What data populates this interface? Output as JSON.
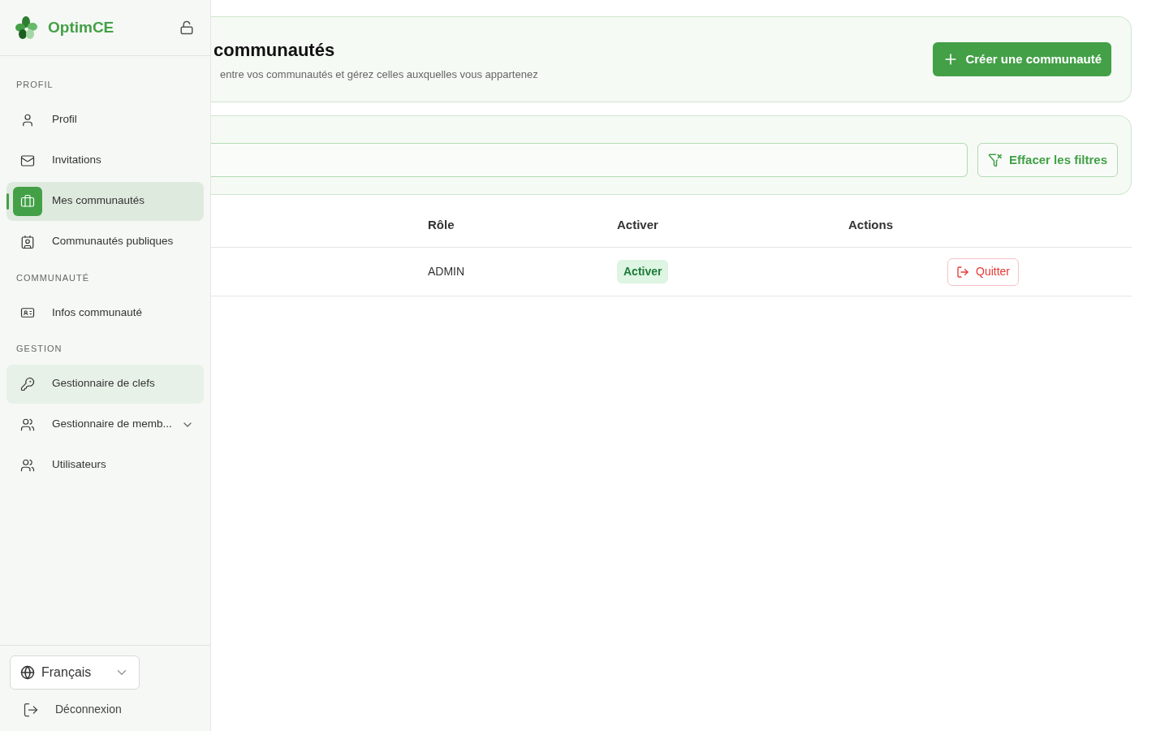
{
  "brand": {
    "name": "OptimCE"
  },
  "sidebar": {
    "sections": [
      {
        "title": "PROFIL",
        "items": [
          {
            "label": "Profil",
            "kind": "user",
            "selected": false,
            "highlighted": false,
            "expandable": false
          },
          {
            "label": "Invitations",
            "kind": "mail",
            "selected": false,
            "highlighted": false,
            "expandable": false
          },
          {
            "label": "Mes communautés",
            "kind": "briefcase",
            "selected": true,
            "highlighted": false,
            "expandable": false
          },
          {
            "label": "Communautés publiques",
            "kind": "contact",
            "selected": false,
            "highlighted": false,
            "expandable": false
          }
        ]
      },
      {
        "title": "COMMUNAUTÉ",
        "items": [
          {
            "label": "Infos communauté",
            "kind": "idcard",
            "selected": false,
            "highlighted": false,
            "expandable": false
          }
        ]
      },
      {
        "title": "GESTION",
        "items": [
          {
            "label": "Gestionnaire de clefs",
            "kind": "key",
            "selected": false,
            "highlighted": true,
            "expandable": false
          },
          {
            "label": "Gestionnaire de memb...",
            "kind": "users",
            "selected": false,
            "highlighted": false,
            "expandable": true
          },
          {
            "label": "Utilisateurs",
            "kind": "users",
            "selected": false,
            "highlighted": false,
            "expandable": false
          }
        ]
      }
    ],
    "language": {
      "value": "Français"
    },
    "logout": "Déconnexion"
  },
  "header": {
    "title": "communautés",
    "subtitle": "entre vos communautés et gérez celles auxquelles vous appartenez",
    "create_button": "Créer une communauté"
  },
  "filters": {
    "clear_button": "Effacer les filtres"
  },
  "table": {
    "columns": [
      "Rôle",
      "Activer",
      "Actions"
    ],
    "rows": [
      {
        "role": "ADMIN",
        "status": "Activer",
        "action": "Quitter"
      }
    ]
  }
}
